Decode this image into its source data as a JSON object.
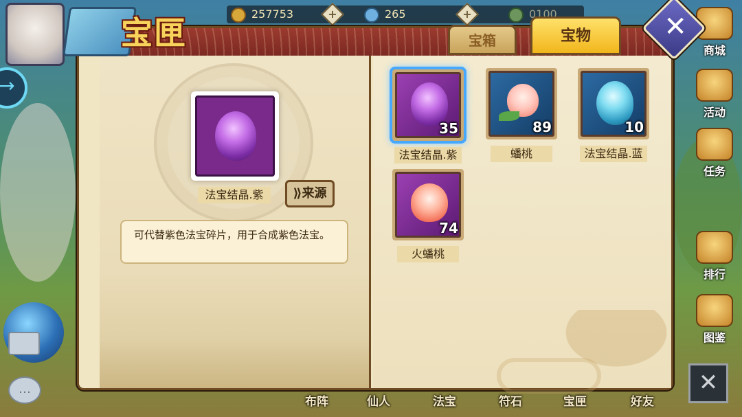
{
  "hud": {
    "gold": "257753",
    "gems": "265",
    "third_value": "0100"
  },
  "side_menu": [
    {
      "label": "商城",
      "icon": "shop-icon"
    },
    {
      "label": "活动",
      "icon": "event-icon"
    },
    {
      "label": "任务",
      "icon": "quest-icon"
    },
    {
      "label": "排行",
      "icon": "ranking-icon"
    },
    {
      "label": "图鉴",
      "icon": "codex-icon"
    }
  ],
  "bottom_nav": [
    "布阵",
    "仙人",
    "法宝",
    "符石",
    "宝匣",
    "好友"
  ],
  "panel": {
    "title": "宝匣",
    "tabs": {
      "chest": "宝箱",
      "treasure": "宝物"
    },
    "active_tab": "treasure",
    "close_symbol": "✕"
  },
  "selected": {
    "name": "法宝结晶.紫",
    "source_label": "来源",
    "description": "可代替紫色法宝碎片，用于合成紫色法宝。"
  },
  "items": [
    {
      "name": "法宝结晶.紫",
      "count": "35",
      "icon": "purple-crystal-icon",
      "selected": true
    },
    {
      "name": "蟠桃",
      "count": "89",
      "icon": "peach-icon",
      "selected": false
    },
    {
      "name": "法宝结晶.蓝",
      "count": "10",
      "icon": "blue-crystal-icon",
      "selected": false
    },
    {
      "name": "火蟠桃",
      "count": "74",
      "icon": "fire-peach-icon",
      "selected": false
    }
  ],
  "corner_close_symbol": "✕"
}
